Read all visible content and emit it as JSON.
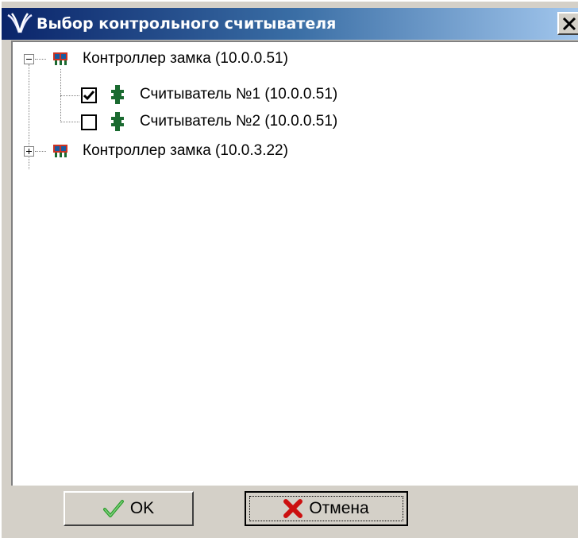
{
  "window": {
    "title": "Выбор контрольного считывателя",
    "app_icon": "wings-logo-icon",
    "close_icon": "close-icon"
  },
  "tree": {
    "nodes": [
      {
        "label": "Контроллер замка (10.0.0.51)",
        "expanded": true,
        "icon": "controller-icon"
      },
      {
        "label": "Считыватель №1 (10.0.0.51)",
        "checked": true,
        "icon": "reader-icon"
      },
      {
        "label": "Считыватель №2 (10.0.0.51)",
        "checked": false,
        "icon": "reader-icon"
      },
      {
        "label": "Контроллер замка (10.0.3.22)",
        "expanded": false,
        "icon": "controller-icon"
      }
    ]
  },
  "buttons": {
    "ok_label": "OK",
    "cancel_label": "Отмена"
  },
  "colors": {
    "title_gradient_start": "#0a246a",
    "title_gradient_end": "#a6caf0",
    "face": "#d4d0c8",
    "check_green": "#2e9e2e",
    "cancel_red": "#cc1010"
  }
}
